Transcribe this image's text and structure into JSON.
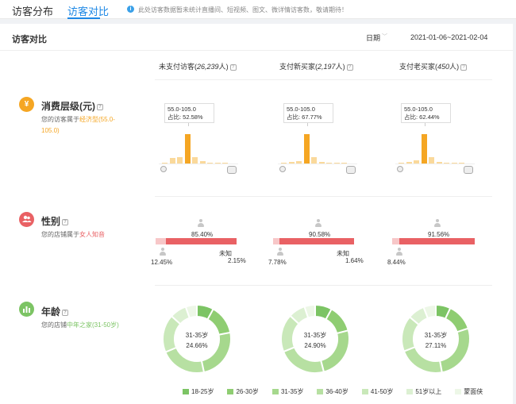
{
  "tabs": [
    {
      "label": "访客分布",
      "active": false
    },
    {
      "label": "访客对比",
      "active": true
    }
  ],
  "notice": "此处访客数据暂未统计直播间、短视频、图文、微详情访客数，敬请期待！",
  "panel": {
    "title": "访客对比",
    "date_label": "日期",
    "date_range": "2021-01-06~2021-02-04"
  },
  "columns": [
    {
      "label": "未支付访客",
      "count": "26,239",
      "unit": "人"
    },
    {
      "label": "支付新买家",
      "count": "2,197",
      "unit": "人"
    },
    {
      "label": "支付老买家",
      "count": "450",
      "unit": "人"
    }
  ],
  "sections": {
    "consumption": {
      "title": "消费层级(元)",
      "desc_prefix": "您的访客属于",
      "desc_highlight": "经济型(55.0-105.0)",
      "icon": "yen-icon",
      "color": "#f5a623"
    },
    "gender": {
      "title": "性别",
      "desc_prefix": "您的店铺属于",
      "desc_highlight": "女人知音",
      "icon": "people-icon",
      "color": "#e96164"
    },
    "age": {
      "title": "年龄",
      "desc_prefix": "您的店铺",
      "desc_highlight": "中年之家(31-50岁)",
      "icon": "chart-icon",
      "color": "#7cc464"
    }
  },
  "chart_data": [
    {
      "type": "bar",
      "group": "消费层级",
      "charts": [
        {
          "tooltip_range": "55.0-105.0",
          "tooltip_share_label": "占比:",
          "tooltip_share": "52.58%",
          "values": [
            0.5,
            10,
            11,
            52.58,
            12,
            4.5,
            2,
            1,
            0.5
          ],
          "highlight_index": 3
        },
        {
          "tooltip_range": "55.0-105.0",
          "tooltip_share_label": "占比:",
          "tooltip_share": "67.77%",
          "values": [
            0.5,
            3,
            6,
            67.77,
            15,
            4,
            1.5,
            0.5,
            0.5
          ],
          "highlight_index": 3
        },
        {
          "tooltip_range": "55.0-105.0",
          "tooltip_share_label": "占比:",
          "tooltip_share": "62.44%",
          "values": [
            0.5,
            3,
            7,
            62.44,
            14,
            4,
            2,
            1.5,
            0.5
          ],
          "highlight_index": 3
        }
      ],
      "colors": {
        "highlight": "#f5a623",
        "normal": "#fad99b"
      }
    },
    {
      "type": "bar",
      "group": "性别",
      "charts": [
        {
          "female": "85.40%",
          "male": "12.45%",
          "unknown_label": "未知",
          "unknown": "2.15%",
          "female_value": 85.4,
          "male_value": 12.45
        },
        {
          "female": "90.58%",
          "male": "7.78%",
          "unknown_label": "未知",
          "unknown": "1.64%",
          "female_value": 90.58,
          "male_value": 7.78
        },
        {
          "female": "91.56%",
          "male": "8.44%",
          "unknown_label": "",
          "unknown": "",
          "female_value": 91.56,
          "male_value": 8.44
        }
      ]
    },
    {
      "type": "pie",
      "group": "年龄",
      "legend": [
        "18-25岁",
        "26-30岁",
        "31-35岁",
        "36-40岁",
        "41-50岁",
        "51岁以上",
        "蒙面侠"
      ],
      "colors": [
        "#7cc464",
        "#8fcd72",
        "#a6d88d",
        "#b7e0a2",
        "#c9e8b9",
        "#dcf0d2",
        "#edf7e7"
      ],
      "charts": [
        {
          "center_label": "31-35岁",
          "center_value": "24.66%",
          "values": [
            8,
            14,
            24.66,
            22,
            18,
            8,
            5.34
          ]
        },
        {
          "center_label": "31-35岁",
          "center_value": "24.90%",
          "values": [
            8,
            13,
            24.9,
            23,
            18,
            8,
            5.1
          ]
        },
        {
          "center_label": "31-35岁",
          "center_value": "27.11%",
          "values": [
            7,
            13,
            27.11,
            22,
            17,
            8,
            5.89
          ]
        }
      ]
    }
  ]
}
